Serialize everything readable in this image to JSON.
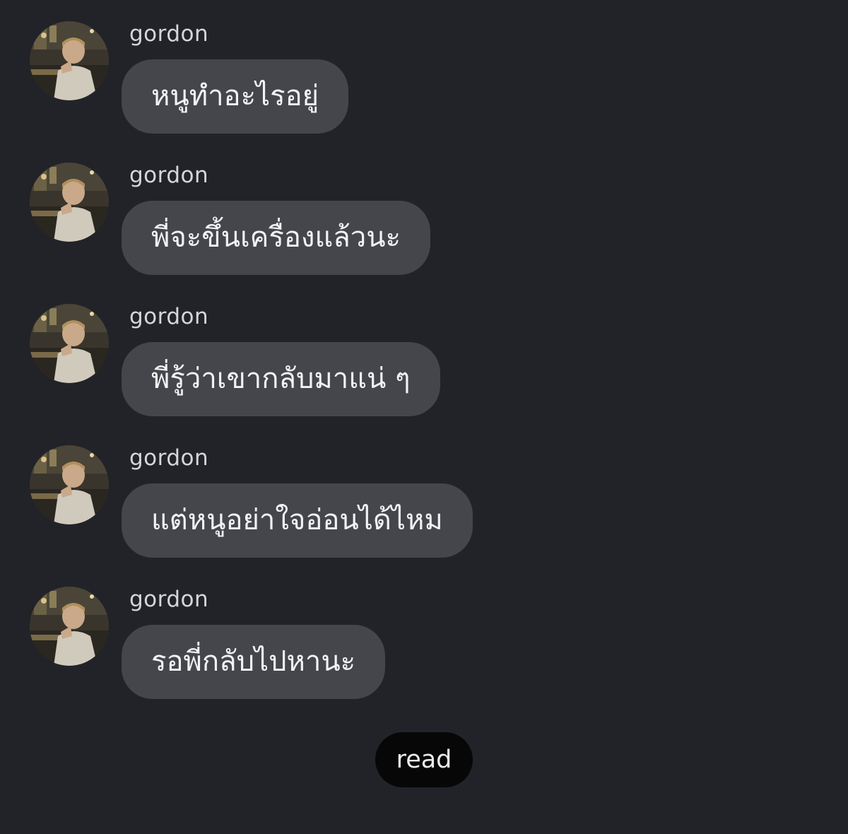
{
  "messages": [
    {
      "sender": "gordon",
      "text": "หนูทำอะไรอยู่"
    },
    {
      "sender": "gordon",
      "text": "พี่จะขึ้นเครื่องแล้วนะ"
    },
    {
      "sender": "gordon",
      "text": "พี่รู้ว่าเขากลับมาแน่ ๆ"
    },
    {
      "sender": "gordon",
      "text": "แต่หนูอย่าใจอ่อนได้ไหม"
    },
    {
      "sender": "gordon",
      "text": "รอพี่กลับไปหานะ"
    }
  ],
  "avatar_icon": "user-avatar-photo",
  "read_receipt": "read",
  "colors": {
    "background": "#222328",
    "bubble": "#45464c",
    "text": "#f2f2f4",
    "sender": "#d6d6da",
    "read_pill": "#070708"
  }
}
